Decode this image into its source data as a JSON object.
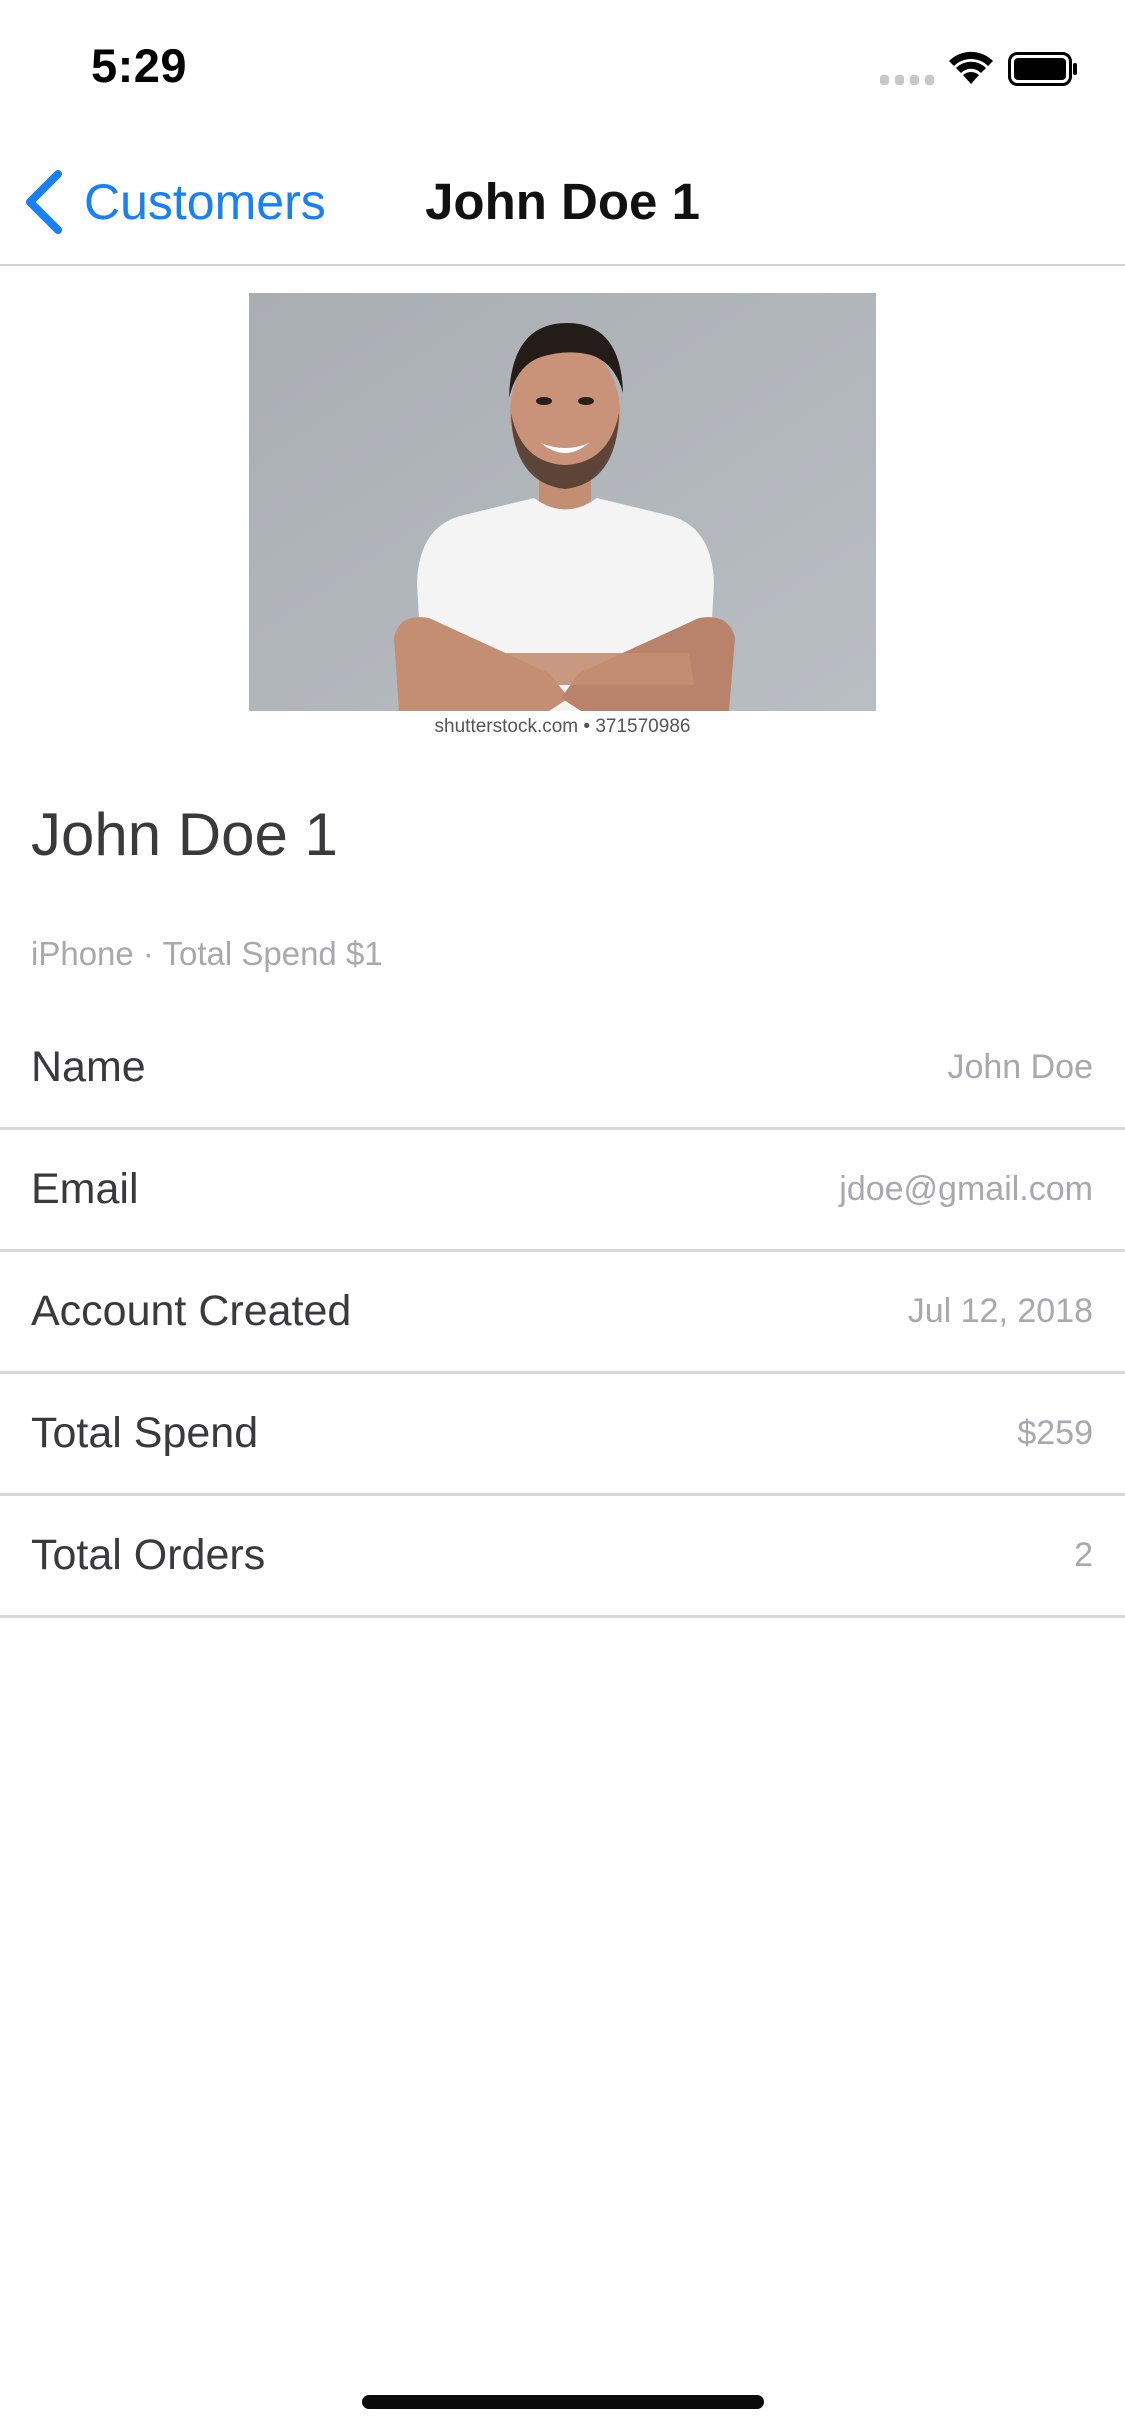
{
  "status_bar": {
    "time": "5:29",
    "signal_icon": "cellular-signal-icon",
    "wifi_icon": "wifi-icon",
    "battery_icon": "battery-icon"
  },
  "nav": {
    "back_label": "Customers",
    "back_icon": "chevron-left-icon",
    "title": "John Doe 1",
    "accent_color": "#1680f4"
  },
  "photo": {
    "watermark": "shutterstock.com • 371570986"
  },
  "header": {
    "name": "John Doe 1",
    "subtitle": "iPhone · Total Spend $1"
  },
  "details": [
    {
      "label": "Name",
      "value": "John Doe"
    },
    {
      "label": "Email",
      "value": "jdoe@gmail.com"
    },
    {
      "label": "Account Created",
      "value": "Jul 12, 2018"
    },
    {
      "label": "Total Spend",
      "value": "$259"
    },
    {
      "label": "Total Orders",
      "value": "2"
    }
  ]
}
